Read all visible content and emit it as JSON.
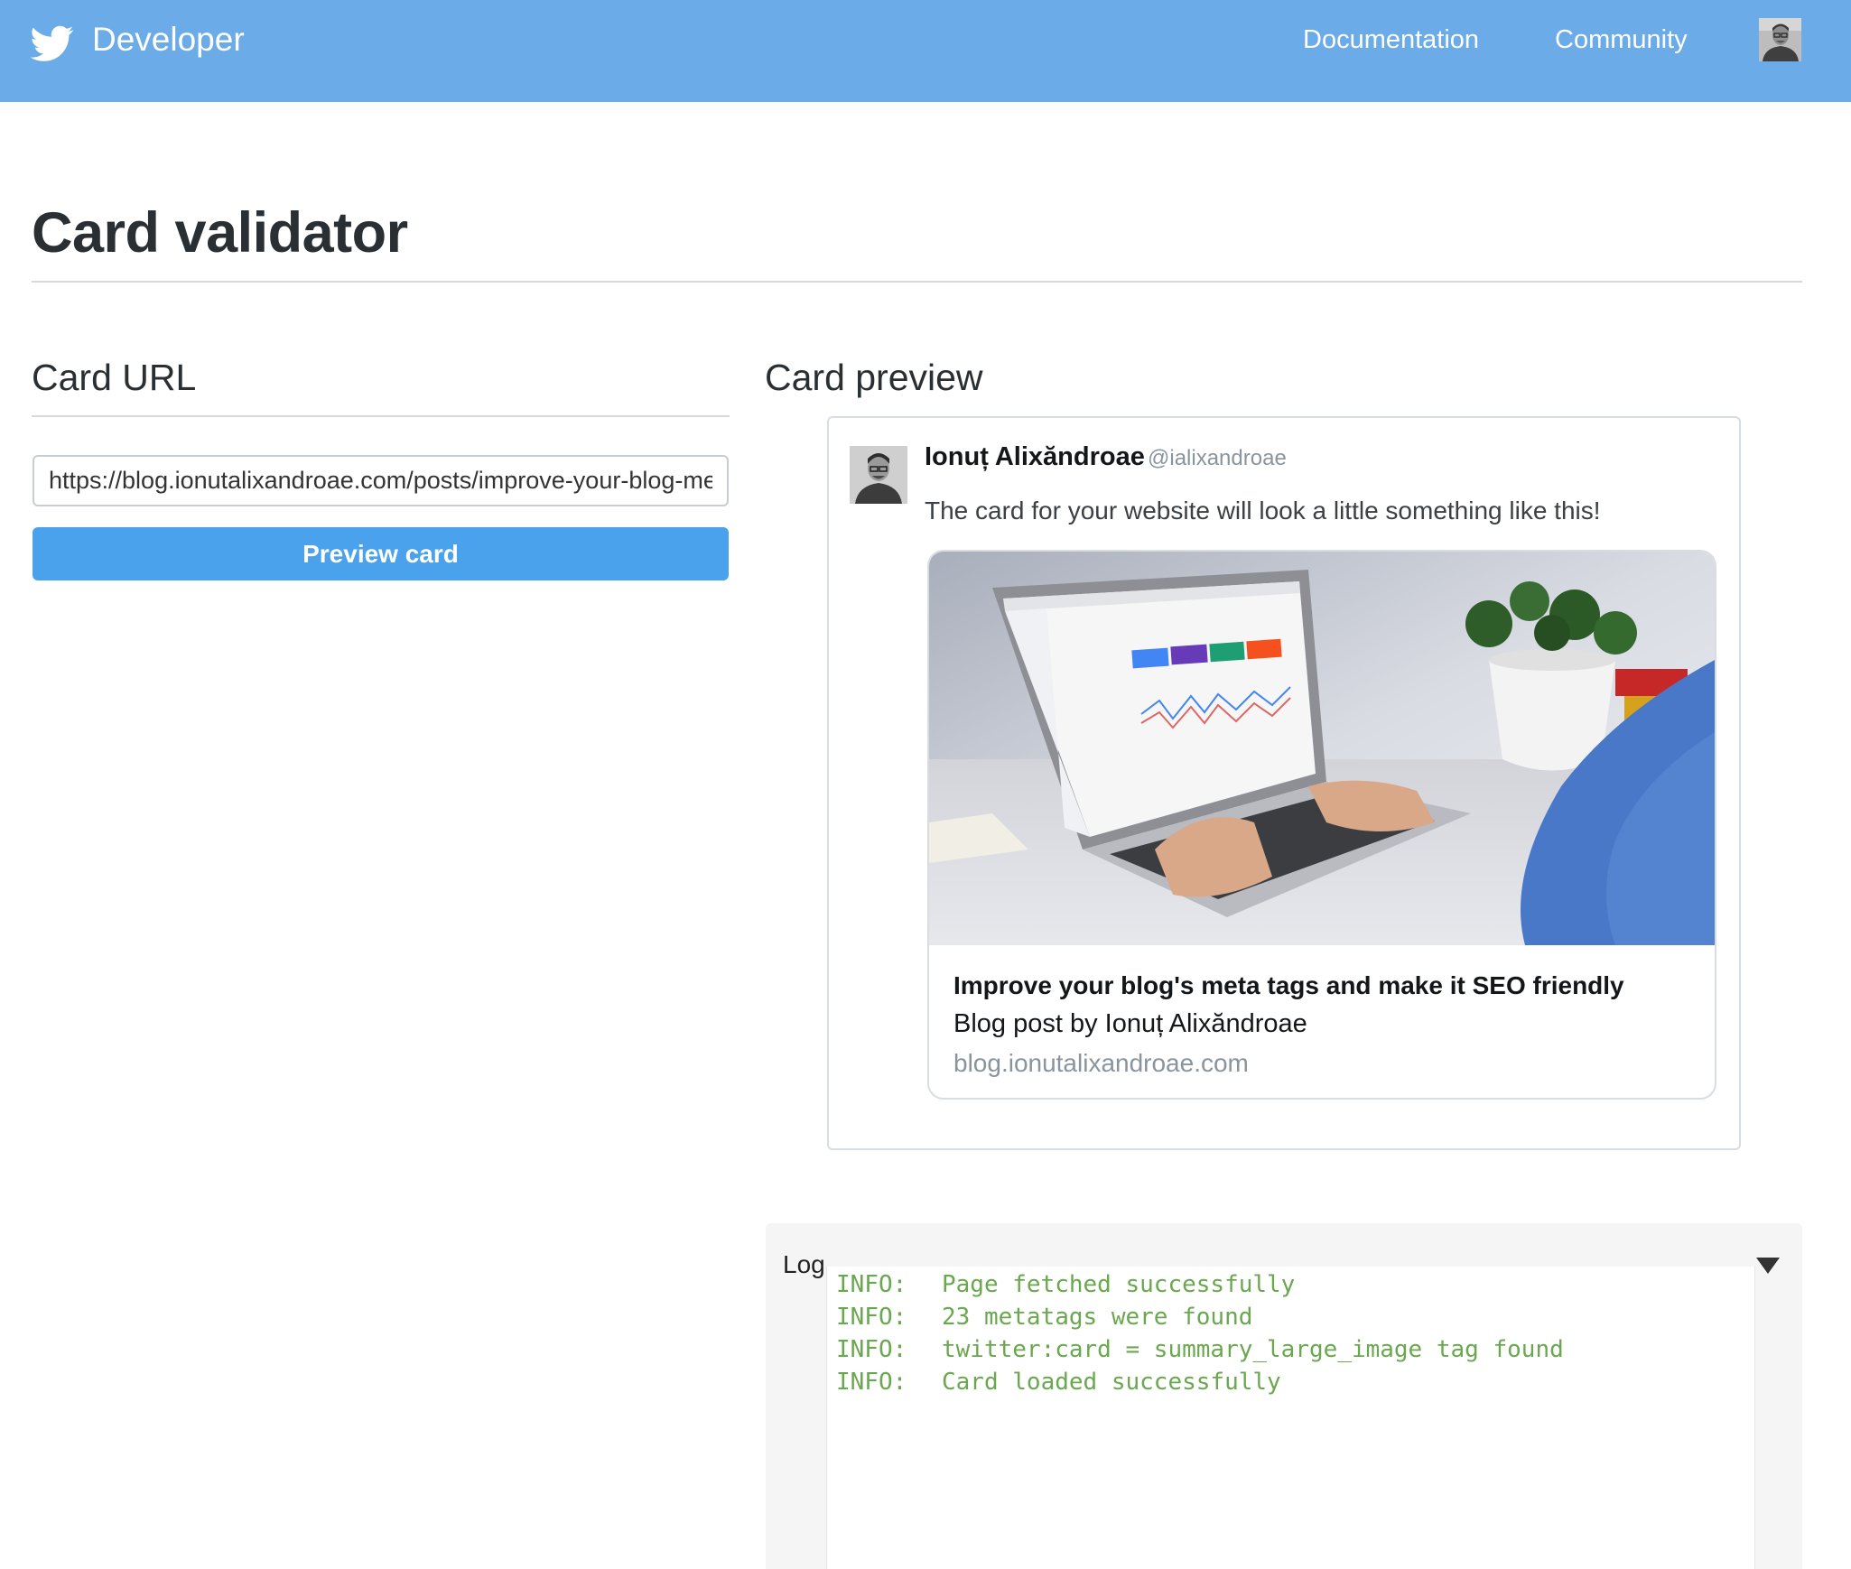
{
  "header": {
    "brand": "Developer",
    "nav": {
      "documentation": "Documentation",
      "community": "Community"
    },
    "colors": {
      "bar": "#6aabe8"
    }
  },
  "page": {
    "title": "Card validator"
  },
  "card_url": {
    "heading": "Card URL",
    "input_value": "https://blog.ionutalixandroae.com/posts/improve-your-blog-meta-tags",
    "button_label": "Preview card",
    "button_color": "#4aa1ec"
  },
  "card_preview": {
    "heading": "Card preview",
    "tweet": {
      "author_name": "Ionuț Alixăndroae",
      "author_handle": "@ialixandroae",
      "text": "The card for your website will look a little something like this!"
    },
    "card": {
      "title": "Improve your blog's meta tags and make it SEO friendly",
      "description": "Blog post by Ionuț Alixăndroae",
      "domain": "blog.ionutalixandroae.com"
    }
  },
  "log": {
    "label": "Log",
    "entries": [
      {
        "level": "INFO:",
        "message": "Page fetched successfully"
      },
      {
        "level": "INFO:",
        "message": "23 metatags were found"
      },
      {
        "level": "INFO:",
        "message": "twitter:card = summary_large_image tag found"
      },
      {
        "level": "INFO:",
        "message": "Card loaded successfully"
      }
    ],
    "text_color": "#6aa84f"
  }
}
